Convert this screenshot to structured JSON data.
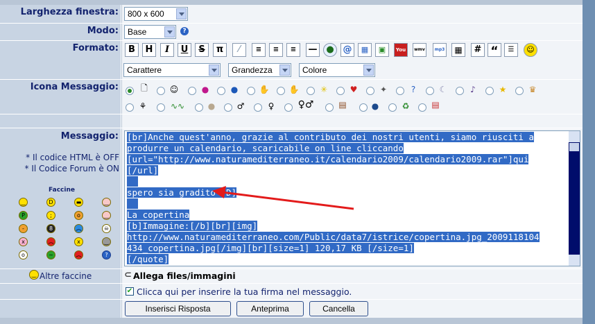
{
  "labels": {
    "window_width": "Larghezza finestra:",
    "mode": "Modo:",
    "format": "Formato:",
    "message_icon": "Icona Messaggio:",
    "message": "Messaggio:",
    "html_code": "* Il codice HTML è OFF",
    "forum_code": "* Il Codice Forum è ON",
    "faccine": "Faccine",
    "more_smileys": "Altre faccine",
    "attach": "Allega files/immagini",
    "signature": "Clicca qui per inserire la tua firma nel messaggio."
  },
  "selects": {
    "window_width": "800 x 600",
    "mode": "Base",
    "font": "Carattere",
    "size": "Grandezza",
    "color": "Colore"
  },
  "toolbar": {
    "bold": "B",
    "heading": "H",
    "italic": "I",
    "underline": "U",
    "strike": "S",
    "pi": "π",
    "hash": "#",
    "quote": "“"
  },
  "message_lines": [
    "[br]Anche quest'anno, grazie al contributo dei nostri utenti, siamo riusciti a",
    "produrre un calendario, scaricabile on line cliccando",
    "[url=\"http://www.naturamediterraneo.it/calendario2009/calendario2009.rar\"]qui",
    "[/url]",
    " ",
    "spero sia gradito :D]",
    " ",
    "La copertina",
    "[b]Immagine:[/b][br][img]",
    "http://www.naturamediterraneo.com/Public/data7/istrice/copertina.jpg_2009118104",
    "434_copertina.jpg[/img][br][size=1] 120,17 KB [/size=1]",
    "[/quote]"
  ],
  "buttons": {
    "submit": "Inserisci Risposta",
    "preview": "Anteprima",
    "cancel": "Cancella"
  },
  "colors": {
    "label_text": "#13236e",
    "selection": "#316ac5",
    "arrow": "#e31b1b"
  }
}
